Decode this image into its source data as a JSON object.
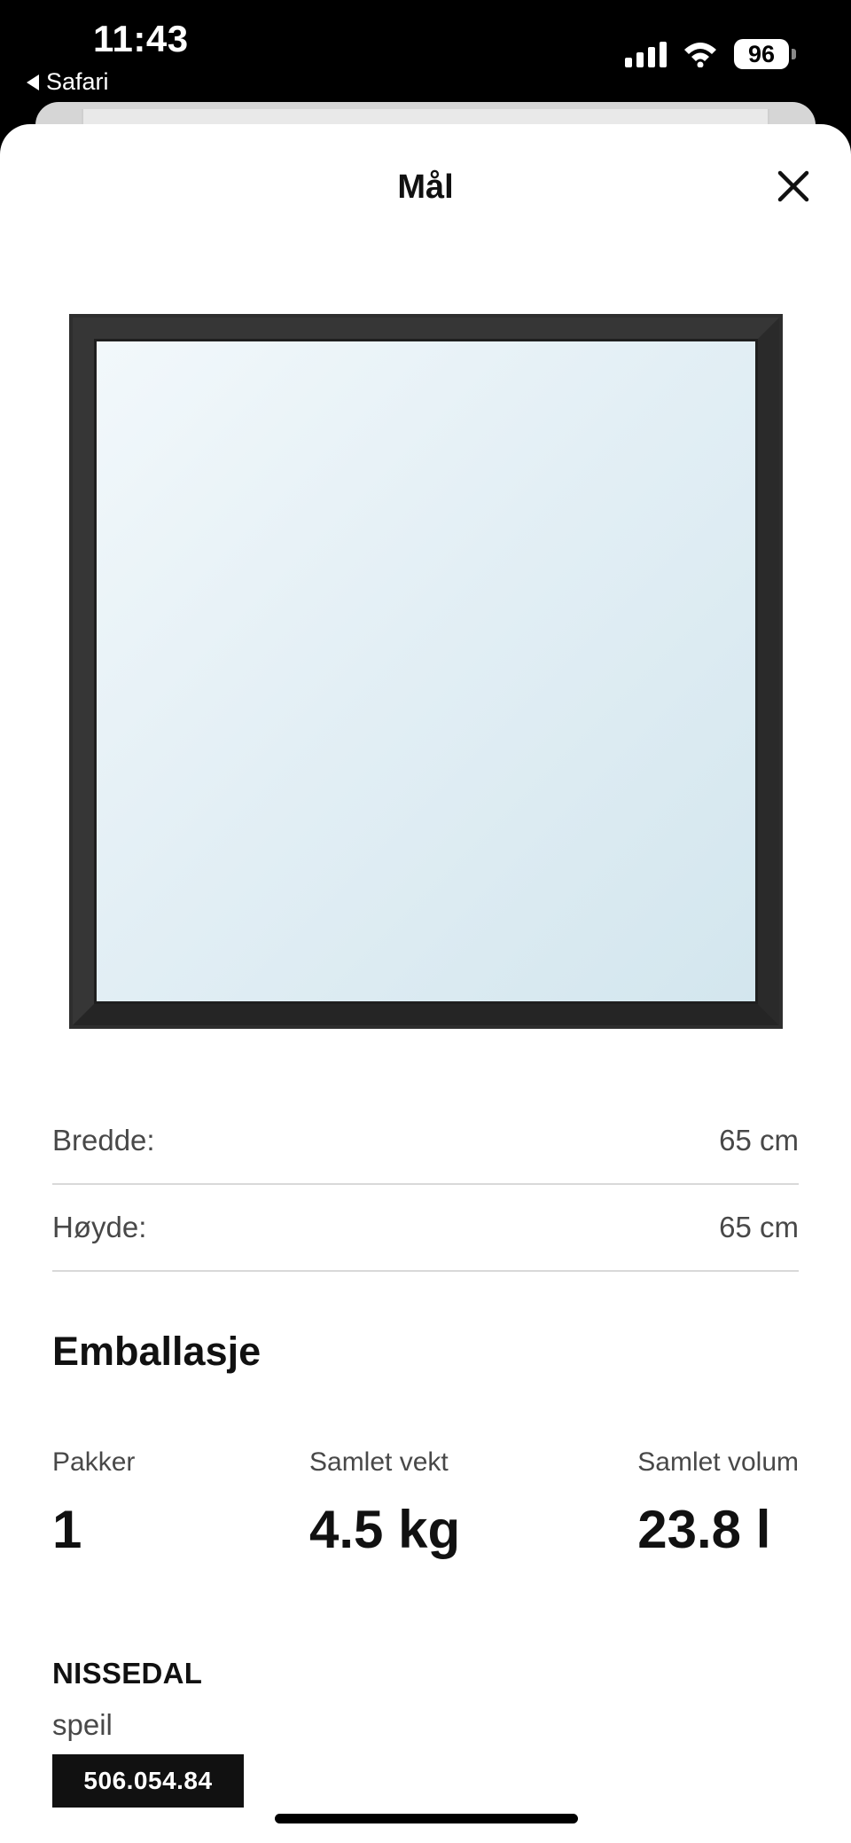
{
  "status_bar": {
    "time": "11:43",
    "back_app": "Safari",
    "battery": "96",
    "icons": [
      "cellular-signal-icon",
      "wifi-icon",
      "battery-icon"
    ]
  },
  "sheet": {
    "title": "Mål",
    "close_icon": "close-icon"
  },
  "product_image": {
    "frame_color": "#2b2b2b",
    "glass_color_light": "#eef6fa",
    "glass_color_dark": "#d6e8f0"
  },
  "dimensions": [
    {
      "label": "Bredde:",
      "value": "65 cm"
    },
    {
      "label": "Høyde:",
      "value": "65 cm"
    }
  ],
  "packaging": {
    "heading": "Emballasje",
    "stats": [
      {
        "label": "Pakker",
        "value": "1"
      },
      {
        "label": "Samlet vekt",
        "value": "4.5 kg"
      },
      {
        "label": "Samlet volum",
        "value": "23.8 l"
      }
    ]
  },
  "product": {
    "name": "NISSEDAL",
    "type": "speil",
    "article_number": "506.054.84"
  }
}
